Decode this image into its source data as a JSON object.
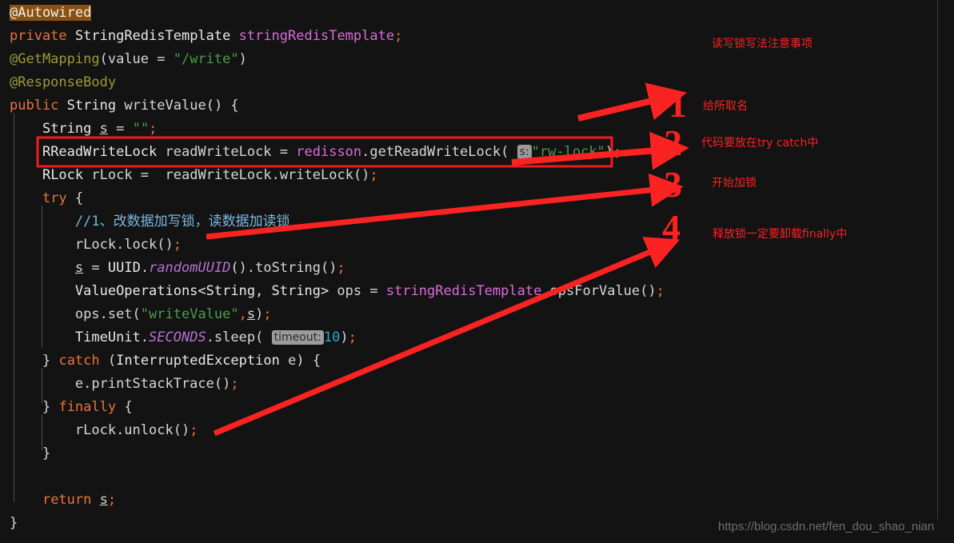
{
  "editor": {
    "background": "#131313",
    "font_size_px": 17,
    "line_height_px": 29,
    "lines": [
      {
        "id": "l1",
        "text": "@Autowired"
      },
      {
        "id": "l2",
        "text": "private StringRedisTemplate stringRedisTemplate;"
      },
      {
        "id": "l3",
        "text": "@GetMapping(value = \"/write\")"
      },
      {
        "id": "l4",
        "text": "@ResponseBody"
      },
      {
        "id": "l5",
        "text": "public String writeValue() {"
      },
      {
        "id": "l6",
        "text": "    String s = \"\";"
      },
      {
        "id": "l7",
        "text": "    RReadWriteLock readWriteLock = redisson.getReadWriteLock( s: \"rw-lock\");"
      },
      {
        "id": "l8",
        "text": "    RLock rLock = readWriteLock.writeLock();"
      },
      {
        "id": "l9",
        "text": "    try {"
      },
      {
        "id": "l10",
        "text": "        //1、改数据加写锁，读数据加读锁"
      },
      {
        "id": "l11",
        "text": "        rLock.lock();"
      },
      {
        "id": "l12",
        "text": "        s = UUID.randomUUID().toString();"
      },
      {
        "id": "l13",
        "text": "        ValueOperations<String, String> ops = stringRedisTemplate.opsForValue();"
      },
      {
        "id": "l14",
        "text": "        ops.set(\"writeValue\",s);"
      },
      {
        "id": "l15",
        "text": "        TimeUnit.SECONDS.sleep( timeout: 10);"
      },
      {
        "id": "l16",
        "text": "    } catch (InterruptedException e) {"
      },
      {
        "id": "l17",
        "text": "        e.printStackTrace();"
      },
      {
        "id": "l18",
        "text": "    } finally {"
      },
      {
        "id": "l19",
        "text": "        rLock.unlock();"
      },
      {
        "id": "l20",
        "text": "    }"
      },
      {
        "id": "l21",
        "text": ""
      },
      {
        "id": "l22",
        "text": "    return s;"
      },
      {
        "id": "l23",
        "text": "}"
      }
    ],
    "tokens": {
      "annotation_autowired": "@Autowired",
      "kw_private": "private",
      "type_string_redis_template": "StringRedisTemplate",
      "field_string_redis_template": "stringRedisTemplate",
      "semi": ";",
      "annotation_get_mapping": "@GetMapping",
      "paren_open": "(",
      "paren_close": ")",
      "value_eq": "value = ",
      "str_write_path": "\"/write\"",
      "annotation_response_body": "@ResponseBody",
      "kw_public": "public",
      "type_string": "String",
      "method_write_value": "writeValue",
      "empty_parens": "()",
      "brace_open": " {",
      "var_s": "s",
      "eq": " = ",
      "str_empty": "\"\"",
      "type_rreadwritelock": "RReadWriteLock",
      "var_read_write_lock": " readWriteLock",
      "field_redisson": "redisson",
      "dot_get_read_write_lock": ".getReadWriteLock",
      "hint_s": "s:",
      "str_rw_lock": "\"rw-lock\"",
      "type_rlock": "RLock",
      "var_rlock": " rLock",
      "dot_write_lock": ".writeLock",
      "kw_try": "try",
      "comment_lock_rule": "//1、改数据加写锁，读数据加读锁",
      "call_rlock_lock": "rLock.lock",
      "type_uuid": "UUID",
      "stat_random_uuid": "randomUUID",
      "call_to_string": ".toString",
      "type_value_operations": "ValueOperations",
      "generic_params": "<String, String>",
      "var_ops": " ops",
      "call_ops_for_value": ".opsForValue",
      "call_ops_set": "ops.set",
      "str_write_value": "\"writeValue\"",
      "type_time_unit": "TimeUnit",
      "stat_seconds": "SECONDS",
      "call_sleep": ".sleep",
      "hint_timeout": "timeout:",
      "num_ten": "10",
      "kw_catch": "catch",
      "type_interrupted_exception": "InterruptedException",
      "var_e": " e",
      "call_print_stack_trace": "e.printStackTrace",
      "kw_finally": "finally",
      "call_rlock_unlock": "rLock.unlock",
      "brace_close": "}",
      "kw_return": "return"
    }
  },
  "annotations": {
    "accent_color": "#fb2222",
    "title": "读写锁写法注意事项",
    "numbers": [
      "1",
      "2",
      "3",
      "4"
    ],
    "notes": [
      "给所取名",
      "代码要放在try catch中",
      "开始加锁",
      "释放锁一定要卸载finally中"
    ],
    "highlight_box_label": "rreadwritelock-line-box"
  },
  "watermark": {
    "text": "https://blog.csdn.net/fen_dou_shao_nian"
  }
}
